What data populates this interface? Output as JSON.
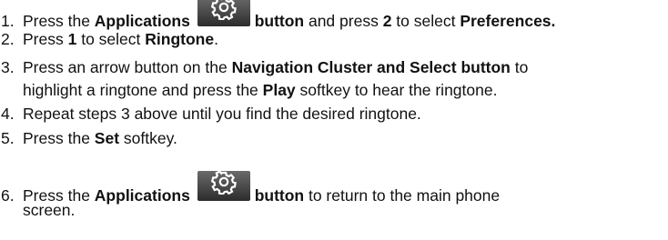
{
  "steps": [
    {
      "number": "1.",
      "parts": [
        "Press the ",
        "Applications",
        "button",
        " and press ",
        "2",
        " to select ",
        "Preferences."
      ]
    },
    {
      "number": "2.",
      "parts": [
        "Press ",
        "1",
        " to select ",
        "Ringtone",
        "."
      ]
    },
    {
      "number": "3.",
      "parts": [
        "Press an arrow button on the ",
        "Navigation Cluster and Select button",
        " to"
      ],
      "continuation": [
        "highlight a ringtone and press the ",
        "Play",
        " softkey to hear the ringtone."
      ]
    },
    {
      "number": "4.",
      "parts": [
        "Repeat steps 3 above until you find the desired ringtone."
      ]
    },
    {
      "number": "5.",
      "parts": [
        "Press the ",
        "Set",
        " softkey."
      ]
    },
    {
      "number": "6.",
      "parts": [
        "Press the ",
        "Applications",
        "button",
        " to return to the main phone"
      ],
      "continuation": [
        "screen."
      ]
    }
  ],
  "icons": {
    "applications": "gear-icon",
    "icon_background": "#3a3a3a",
    "icon_glyph": "#ffffff"
  }
}
